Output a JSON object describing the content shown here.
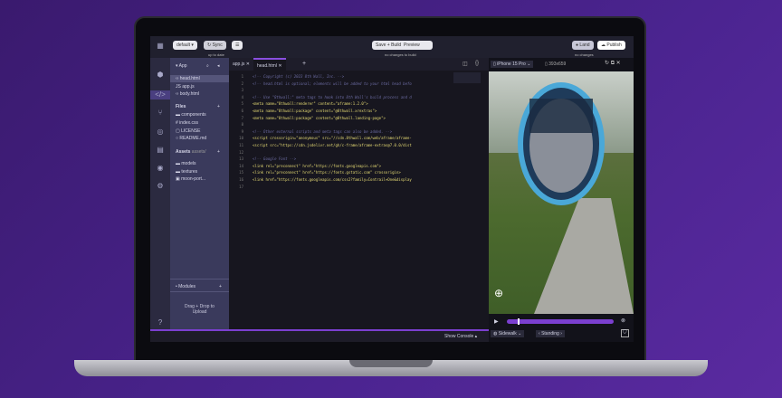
{
  "topbar": {
    "branch": "default",
    "sync": "Sync",
    "sync_status": "up to date",
    "save_build": "Save + Build",
    "preview": "Preview",
    "build_status": "no changes to build",
    "land": "Land",
    "publish": "Publish",
    "land_status": "no changes"
  },
  "files": {
    "app_label": "App",
    "app_items": [
      "head.html",
      "app.js",
      "body.html"
    ],
    "files_label": "Files",
    "file_items": [
      "components",
      "index.css",
      "LICENSE",
      "README.md"
    ],
    "assets_label": "Assets",
    "assets_path": "assets/",
    "asset_items": [
      "models",
      "textures",
      "moon-port..."
    ],
    "modules_label": "Modules",
    "upload": "Drag + Drop to Upload"
  },
  "editor": {
    "tabs": [
      "app.js",
      "head.html"
    ],
    "active_tab": 1,
    "lines": [
      {
        "t": "<!-- Copyright (c) 2023 8th Wall, Inc. -->",
        "c": true
      },
      {
        "t": "<!-- head.html is optional; elements will be added to your html head befo",
        "c": true
      },
      {
        "t": "",
        "c": false
      },
      {
        "t": "<!-- Use \"8thwall:\" meta tags to hook into 8th Wall's build process and d",
        "c": true
      },
      {
        "t": "<meta name=\"8thwall:renderer\" content=\"aframe:1.2.0\">",
        "c": false
      },
      {
        "t": "<meta name=\"8thwall:package\" content=\"@8thwall.xrextras\">",
        "c": false
      },
      {
        "t": "<meta name=\"8thwall:package\" content=\"@8thwall.landing-page\">",
        "c": false
      },
      {
        "t": "",
        "c": false
      },
      {
        "t": "<!-- Other external scripts and meta tags can also be added. -->",
        "c": true
      },
      {
        "t": "<script crossorigin=\"anonymous\" src=\"//cdn.8thwall.com/web/aframe/aframe-",
        "c": false
      },
      {
        "t": "<script src=\"https://cdn.jsdelivr.net/gh/c-frame/aframe-extras@7.0.0/dist",
        "c": false
      },
      {
        "t": "",
        "c": false
      },
      {
        "t": "<!-- Google Font -->",
        "c": true
      },
      {
        "t": "<link rel=\"preconnect\" href=\"https://fonts.googleapis.com\">",
        "c": false
      },
      {
        "t": "<link rel=\"preconnect\" href=\"https://fonts.gstatic.com\" crossorigin>",
        "c": false
      },
      {
        "t": "<link href=\"https://fonts.googleapis.com/css2?family=Contrail+One&display",
        "c": false
      },
      {
        "t": "",
        "c": false
      }
    ],
    "show_console": "Show Console"
  },
  "preview": {
    "device": "iPhone 15 Pro",
    "resolution": "393x659",
    "location": "Sidewalk",
    "pose": "Standing",
    "timeline_progress": 0.1
  }
}
